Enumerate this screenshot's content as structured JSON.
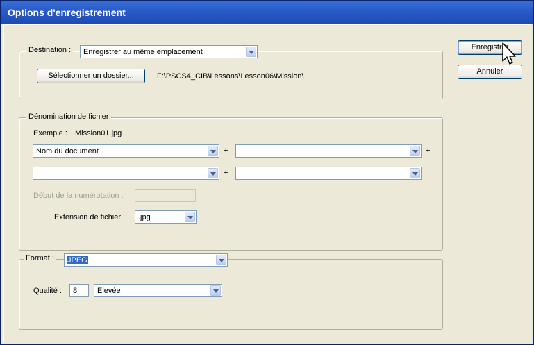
{
  "window": {
    "title": "Options d'enregistrement"
  },
  "buttons": {
    "save": "Enregistrer",
    "cancel": "Annuler"
  },
  "destination": {
    "legend": "Destination :",
    "selected": "Enregistrer au même emplacement",
    "select_folder": "Sélectionner un dossier...",
    "path": "F:\\PSCS4_CIB\\Lessons\\Lesson06\\Mission\\"
  },
  "naming": {
    "legend": "Dénomination de fichier",
    "example_label": "Exemple :",
    "example_value": "Mission01.jpg",
    "field1": "Nom du document",
    "field2": "",
    "field3": "",
    "field4": "",
    "plus": "+",
    "start_number_label": "Début de la numérotation :",
    "start_number_value": "",
    "extension_label": "Extension de fichier :",
    "extension_value": ".jpg"
  },
  "format": {
    "legend": "Format :",
    "selected": "JPEG",
    "quality_label": "Qualité :",
    "quality_value": "8",
    "quality_preset": "Elevée"
  }
}
